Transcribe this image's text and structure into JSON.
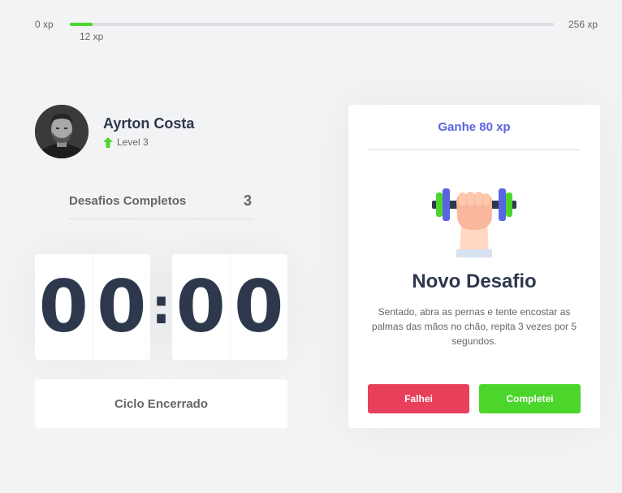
{
  "xp": {
    "min_label": "0 xp",
    "max_label": "256 xp",
    "current_label": "12 xp",
    "progress_fraction": 0.047,
    "fill_color": "#4cd62b"
  },
  "profile": {
    "name": "Ayrton Costa",
    "level_label": "Level 3",
    "level_icon": "level-up-arrow-icon"
  },
  "completed": {
    "label": "Desafios Completos",
    "count": "3"
  },
  "countdown": {
    "minute_left": "0",
    "minute_right": "0",
    "separator": ":",
    "second_left": "0",
    "second_right": "0"
  },
  "cycle_button_label": "Ciclo Encerrado",
  "challenge": {
    "header": "Ganhe 80 xp",
    "icon": "dumbbell-icon",
    "title": "Novo Desafio",
    "description": "Sentado, abra as pernas e tente encostar as palmas das mãos no chão, repita 3 vezes por 5 segundos.",
    "fail_label": "Falhei",
    "complete_label": "Completei"
  },
  "colors": {
    "background": "#f2f3f5",
    "title": "#2e384d",
    "text": "#666666",
    "blue": "#5965e0",
    "green": "#4cd62b",
    "red": "#e83f5b"
  }
}
